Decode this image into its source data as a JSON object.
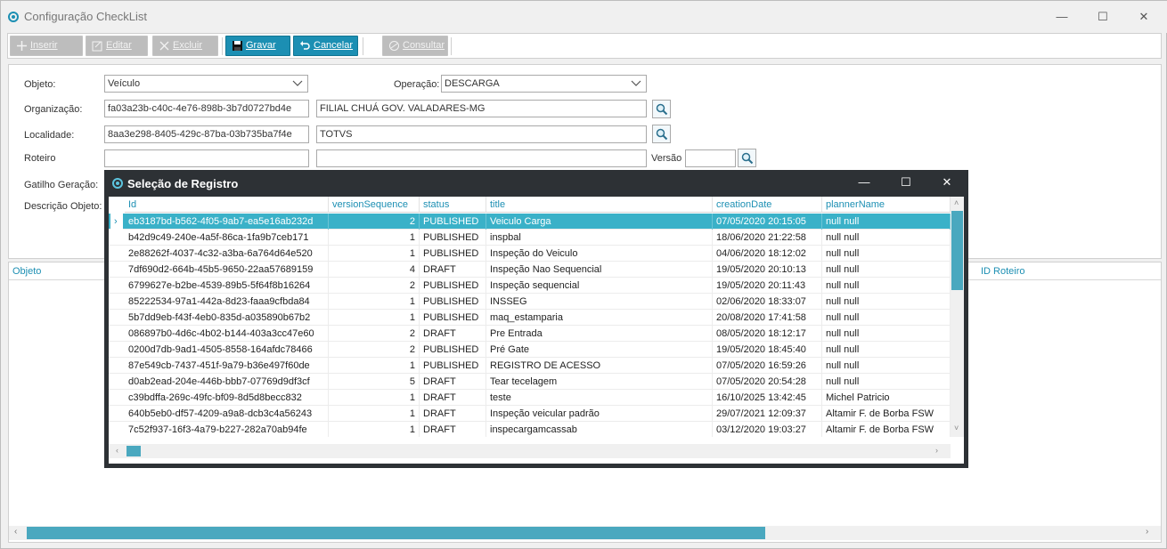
{
  "window": {
    "title": "Configuração CheckList",
    "minimize": "—",
    "maximize": "☐",
    "close": "✕"
  },
  "toolbar": {
    "insert_label": "Inserir",
    "edit_label": "Editar",
    "delete_label": "Excluir",
    "save_label": "Gravar",
    "cancel_label": "Cancelar",
    "query_label": "Consultar"
  },
  "form": {
    "objeto_label": "Objeto:",
    "objeto_value": "Veículo",
    "operacao_label": "Operação:",
    "operacao_value": "DESCARGA",
    "organizacao_label": "Organização:",
    "organizacao_id": "fa03a23b-c40c-4e76-898b-3b7d0727bd4e",
    "organizacao_name": "FILIAL CHUÁ GOV. VALADARES-MG",
    "localidade_label": "Localidade:",
    "localidade_id": "8aa3e298-8405-429c-87ba-03b735ba7f4e",
    "localidade_name": "TOTVS",
    "roteiro_label": "Roteiro",
    "roteiro_id": "",
    "roteiro_name": "",
    "versao_label": "Versão",
    "versao_value": "",
    "gatilho_label": "Gatilho Geração:",
    "descricao_label": "Descrição Objeto:"
  },
  "grid": {
    "col_objeto": "Objeto",
    "col_id_roteiro": "ID Roteiro"
  },
  "modal": {
    "title": "Seleção de Registro",
    "minimize": "—",
    "maximize": "☐",
    "close": "✕",
    "columns": [
      "Id",
      "versionSequence",
      "status",
      "title",
      "creationDate",
      "plannerName"
    ],
    "rows": [
      {
        "id": "eb3187bd-b562-4f05-9ab7-ea5e16ab232d",
        "seq": "2",
        "status": "PUBLISHED",
        "title": "Veiculo Carga",
        "date": "07/05/2020 20:15:05",
        "planner": "null null"
      },
      {
        "id": "b42d9c49-240e-4a5f-86ca-1fa9b7ceb171",
        "seq": "1",
        "status": "PUBLISHED",
        "title": "inspbal",
        "date": "18/06/2020 21:22:58",
        "planner": "null null"
      },
      {
        "id": "2e88262f-4037-4c32-a3ba-6a764d64e520",
        "seq": "1",
        "status": "PUBLISHED",
        "title": "Inspeção do Veiculo",
        "date": "04/06/2020 18:12:02",
        "planner": "null null"
      },
      {
        "id": "7df690d2-664b-45b5-9650-22aa57689159",
        "seq": "4",
        "status": "DRAFT",
        "title": "Inspeção Nao Sequencial",
        "date": "19/05/2020 20:10:13",
        "planner": "null null"
      },
      {
        "id": "6799627e-b2be-4539-89b5-5f64f8b16264",
        "seq": "2",
        "status": "PUBLISHED",
        "title": "Inspeção sequencial",
        "date": "19/05/2020 20:11:43",
        "planner": "null null"
      },
      {
        "id": "85222534-97a1-442a-8d23-faaa9cfbda84",
        "seq": "1",
        "status": "PUBLISHED",
        "title": "INSSEG",
        "date": "02/06/2020 18:33:07",
        "planner": "null null"
      },
      {
        "id": "5b7dd9eb-f43f-4eb0-835d-a035890b67b2",
        "seq": "1",
        "status": "PUBLISHED",
        "title": "maq_estamparia",
        "date": "20/08/2020 17:41:58",
        "planner": "null null"
      },
      {
        "id": "086897b0-4d6c-4b02-b144-403a3cc47e60",
        "seq": "2",
        "status": "DRAFT",
        "title": "Pre Entrada",
        "date": "08/05/2020 18:12:17",
        "planner": "null null"
      },
      {
        "id": "0200d7db-9ad1-4505-8558-164afdc78466",
        "seq": "2",
        "status": "PUBLISHED",
        "title": "Pré Gate",
        "date": "19/05/2020 18:45:40",
        "planner": "null null"
      },
      {
        "id": "87e549cb-7437-451f-9a79-b36e497f60de",
        "seq": "1",
        "status": "PUBLISHED",
        "title": "REGISTRO DE ACESSO",
        "date": "07/05/2020 16:59:26",
        "planner": "null null"
      },
      {
        "id": "d0ab2ead-204e-446b-bbb7-07769d9df3cf",
        "seq": "5",
        "status": "DRAFT",
        "title": "Tear tecelagem",
        "date": "07/05/2020 20:54:28",
        "planner": "null null"
      },
      {
        "id": "c39bdffa-269c-49fc-bf09-8d5d8becc832",
        "seq": "1",
        "status": "DRAFT",
        "title": "teste",
        "date": "16/10/2025 13:42:45",
        "planner": "Michel Patricio"
      },
      {
        "id": "640b5eb0-df57-4209-a9a8-dcb3c4a56243",
        "seq": "1",
        "status": "DRAFT",
        "title": "Inspeção veicular padrão",
        "date": "29/07/2021 12:09:37",
        "planner": "Altamir F. de Borba  FSW"
      },
      {
        "id": "7c52f937-16f3-4a79-b227-282a70ab94fe",
        "seq": "1",
        "status": "DRAFT",
        "title": "inspecargamcassab",
        "date": "03/12/2020 19:03:27",
        "planner": "Altamir F. de Borba  FSW"
      }
    ]
  },
  "colors": {
    "accent": "#1c8fb3",
    "selection": "#3ab1c8",
    "modal_frame": "#2d3135"
  }
}
